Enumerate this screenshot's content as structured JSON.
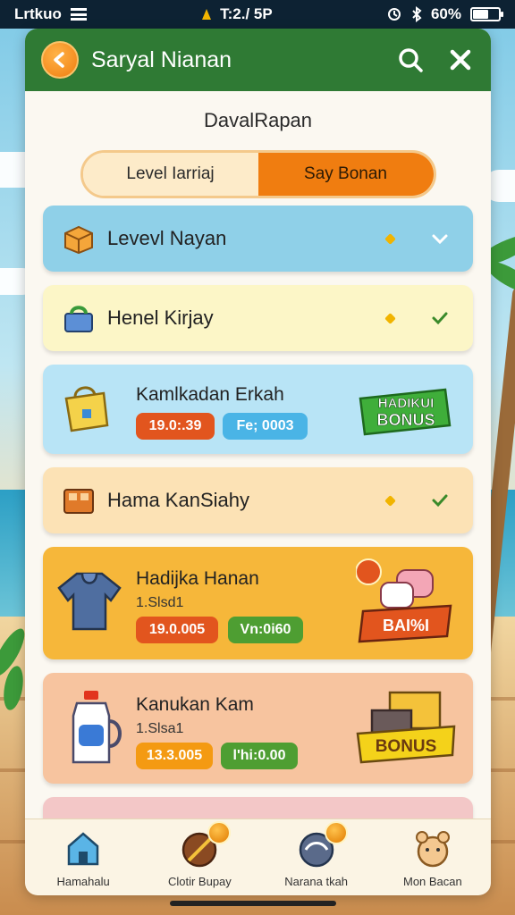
{
  "status_bar": {
    "carrier": "Lrtkuo",
    "time": "T:2./ 5P",
    "battery": "60%",
    "battery_level": 0.6
  },
  "header": {
    "title": "Saryal Nianan",
    "back_icon": "arrow-left-icon",
    "search_icon": "search-icon",
    "close_icon": "close-icon"
  },
  "subtitle": "DavalRapan",
  "toggle": {
    "options": [
      "Level Iarriaj",
      "Say Bonan"
    ],
    "selected_index": 1,
    "selected_color": "#f07d10"
  },
  "cards": [
    {
      "name": "Levevl Nayan",
      "icon": "box-icon",
      "status_icon": "check-icon"
    },
    {
      "name": "Henel Kirjay",
      "icon": "basket-icon",
      "status_icon": "check-icon"
    },
    {
      "name": "Kamlkadan Erkah",
      "icon": "gift-bag-icon",
      "pill1": "19.0:.39",
      "pill2": "Fe; 0003",
      "badge": "HADIKUI BONUS"
    },
    {
      "name": "Hama KanSiahy",
      "icon": "locker-icon",
      "status_icon": "check-icon"
    },
    {
      "name": "Hadijka Hanan",
      "sub": "1.Slsd1",
      "icon": "hoodie-icon",
      "pill1": "19.0.005",
      "pill2": "Vn:0i60",
      "badge": "BAI%I"
    },
    {
      "name": "Kanukan Kam",
      "sub": "1.Slsa1",
      "icon": "bottle-icon",
      "pill1": "13.3.005",
      "pill2": "l'hi:0.00",
      "badge": "BONUS"
    }
  ],
  "bottom_nav": [
    {
      "label": "Hamahalu",
      "icon": "home-icon"
    },
    {
      "label": "Clotir Bupay",
      "icon": "tools-icon"
    },
    {
      "label": "Narana tkah",
      "icon": "globe-icon"
    },
    {
      "label": "Mon Bacan",
      "icon": "pet-icon"
    }
  ]
}
